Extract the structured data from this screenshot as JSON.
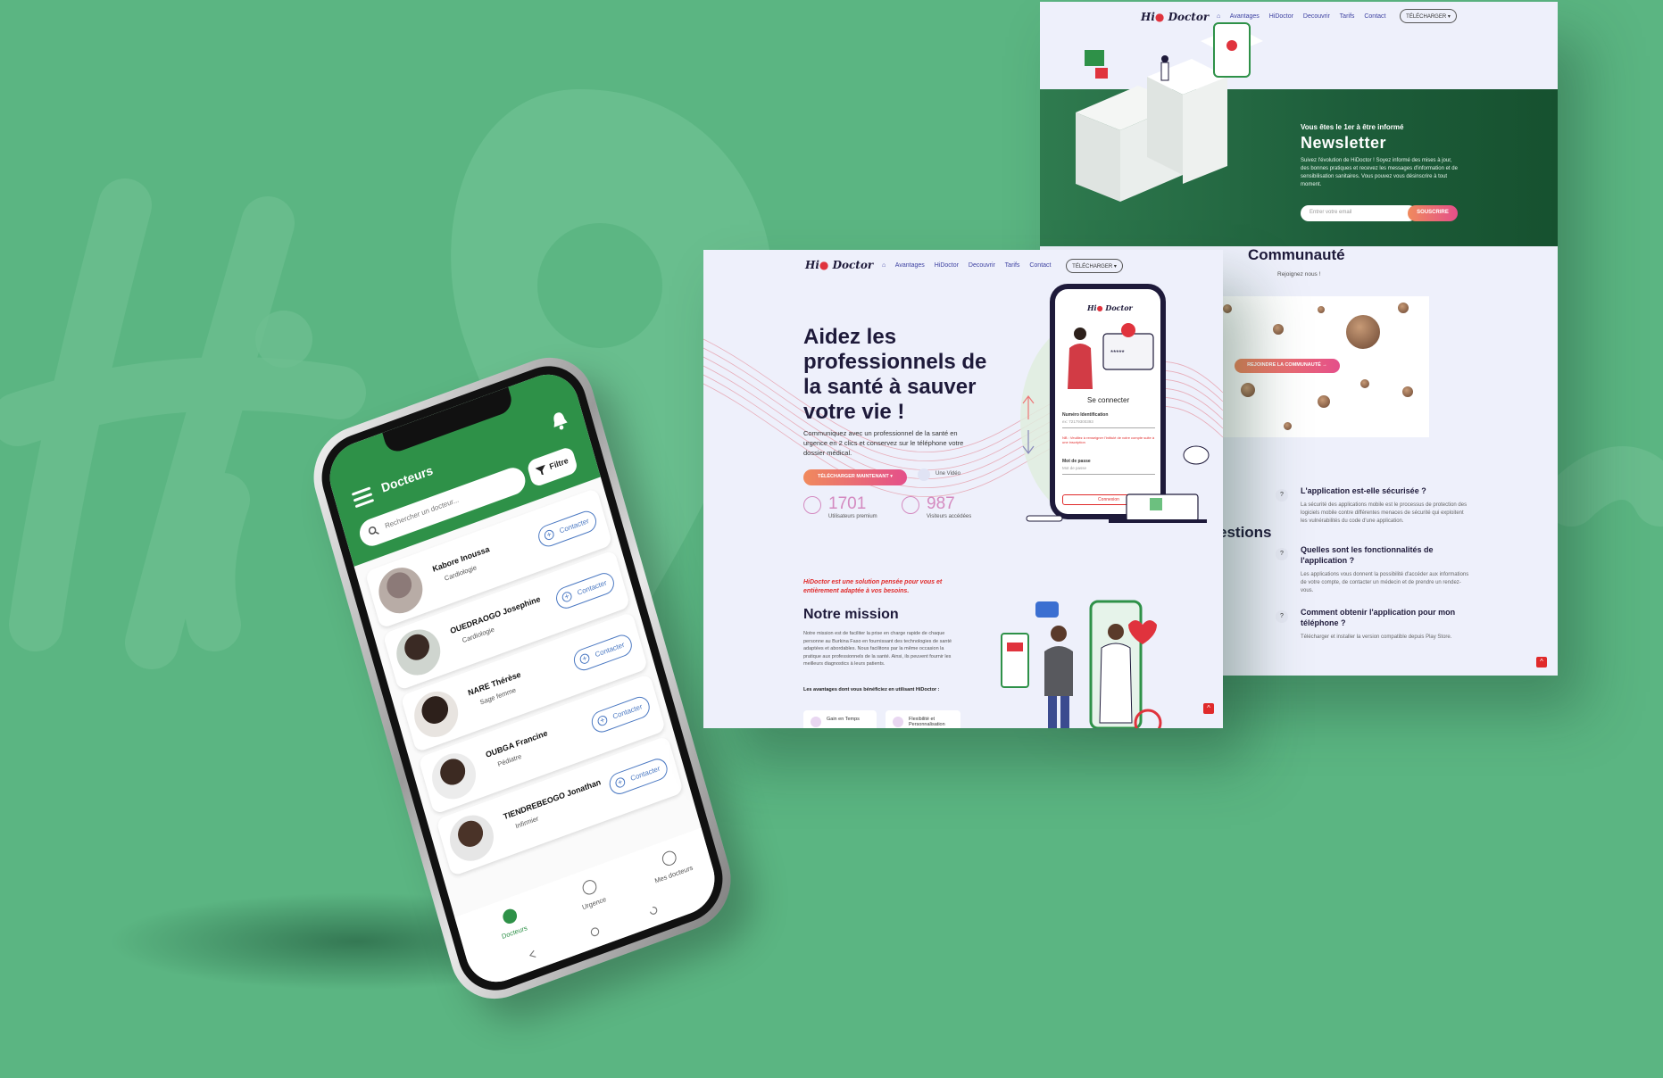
{
  "brand": {
    "accent": "#2e9148",
    "background": "#5bb582",
    "gradient_from": "#f08a5d",
    "gradient_to": "#e44f8a",
    "danger": "#e02a2a"
  },
  "mobile_app": {
    "header_title": "Docteurs",
    "search_placeholder": "Rechercher un docteur...",
    "filter_label": "Filtre",
    "contact_label": "Contacter",
    "doctors": [
      {
        "name": "Kabore Inoussa",
        "specialty": "Cardiologie",
        "avatar_color": "#8c7a78"
      },
      {
        "name": "OUEDRAOGO Josephine",
        "specialty": "Cardiologie",
        "avatar_color": "#3a2a24"
      },
      {
        "name": "NARE Thérèse",
        "specialty": "Sage femme",
        "avatar_color": "#2d201b"
      },
      {
        "name": "OUBGA Francine",
        "specialty": "Pédiatre",
        "avatar_color": "#3c2a22"
      },
      {
        "name": "TIENDREBEOGO Jonathan",
        "specialty": "Infirmier",
        "avatar_color": "#4a3328"
      }
    ],
    "bottom_nav": [
      {
        "label": "Docteurs",
        "icon": "list-icon",
        "active": true
      },
      {
        "label": "Urgence",
        "icon": "location-pin-icon",
        "active": false
      },
      {
        "label": "Mes docteurs",
        "icon": "heart-icon",
        "active": false
      }
    ]
  },
  "website_back": {
    "logo": "Hi Doctor",
    "nav": [
      "Avantages",
      "HiDoctor",
      "Decouvrir",
      "Tarifs",
      "Contact"
    ],
    "download_button": "TÉLÉCHARGER ▾",
    "newsletter": {
      "subtitle": "Vous êtes le 1er à être informé",
      "title": "Newsletter",
      "text": "Suivez l'évolution de HiDoctor ! Soyez informé des mises à jour, des bonnes pratiques et recevez les messages d'information et de sensibilisation sanitaires. Vous pouvez vous désinscrire à tout moment.",
      "input_placeholder": "Entrer votre email",
      "button": "SOUSCRIRE"
    },
    "community": {
      "title": "Communauté",
      "subtitle": "Rejoignez nous !",
      "button": "REJOINDRE LA COMMUNAUTÉ →"
    },
    "faq": {
      "heading_partial": "estions",
      "items": [
        {
          "q": "L'application est-elle sécurisée ?",
          "a": "La sécurité des applications mobile est le processus de protection des logiciels mobile contre différentes menaces de sécurité qui exploitent les vulnérabilités du code d'une application."
        },
        {
          "q": "Quelles sont les fonctionnalités de l'application ?",
          "a": "Les applications vous donnent la possibilité d'accéder aux informations de votre compte, de contacter un médecin et de prendre un rendez-vous."
        },
        {
          "q": "Comment obtenir l'application pour mon téléphone ?",
          "a": "Télécharger et installer la version compatible depuis Play Store."
        }
      ]
    }
  },
  "website_front": {
    "logo": "Hi Doctor",
    "nav": [
      "Avantages",
      "HiDoctor",
      "Decouvrir",
      "Tarifs",
      "Contact"
    ],
    "download_button": "TÉLÉCHARGER ▾",
    "hero": {
      "title": "Aidez les professionnels de la santé à sauver votre vie !",
      "description": "Communiquez avec un professionnel de la santé en urgence en 2 clics et conservez sur le téléphone votre dossier médical.",
      "cta": "TÉLÉCHARGER MAINTENANT ▾",
      "video_label": "Une Vidéo"
    },
    "stats": [
      {
        "value": "1701",
        "label": "Utilisateurs premium"
      },
      {
        "value": "987",
        "label": "Visiteurs accédées"
      }
    ],
    "login_screen": {
      "title": "Se connecter",
      "id_label": "Numéro Identification",
      "id_value": "ex: 72179300393",
      "error": "NB : Veuillez à renseigner l'intitulé de votre compte suite à une inscription",
      "password_label": "Mot de passe",
      "password_placeholder": "Mot de passe",
      "button": "Connexion"
    },
    "mission": {
      "lead": "HiDoctor est une solution pensée pour vous et entièrement adaptée à vos besoins.",
      "title": "Notre mission",
      "text": "Notre mission est de faciliter la prise en charge rapide de chaque personne au Burkina Faso en fournissant des technologies de santé adaptées et abordables. Nous facilitons par la même occasion la pratique aux professionnels de la santé. Ainsi, ils peuvent fournir les meilleurs diagnostics à leurs patients.",
      "advantages_label": "Les avantages dont vous bénéficiez en utilisant HiDoctor :",
      "cards": [
        "Gain en Temps",
        "Flexibilité et Personnalisation"
      ]
    }
  }
}
